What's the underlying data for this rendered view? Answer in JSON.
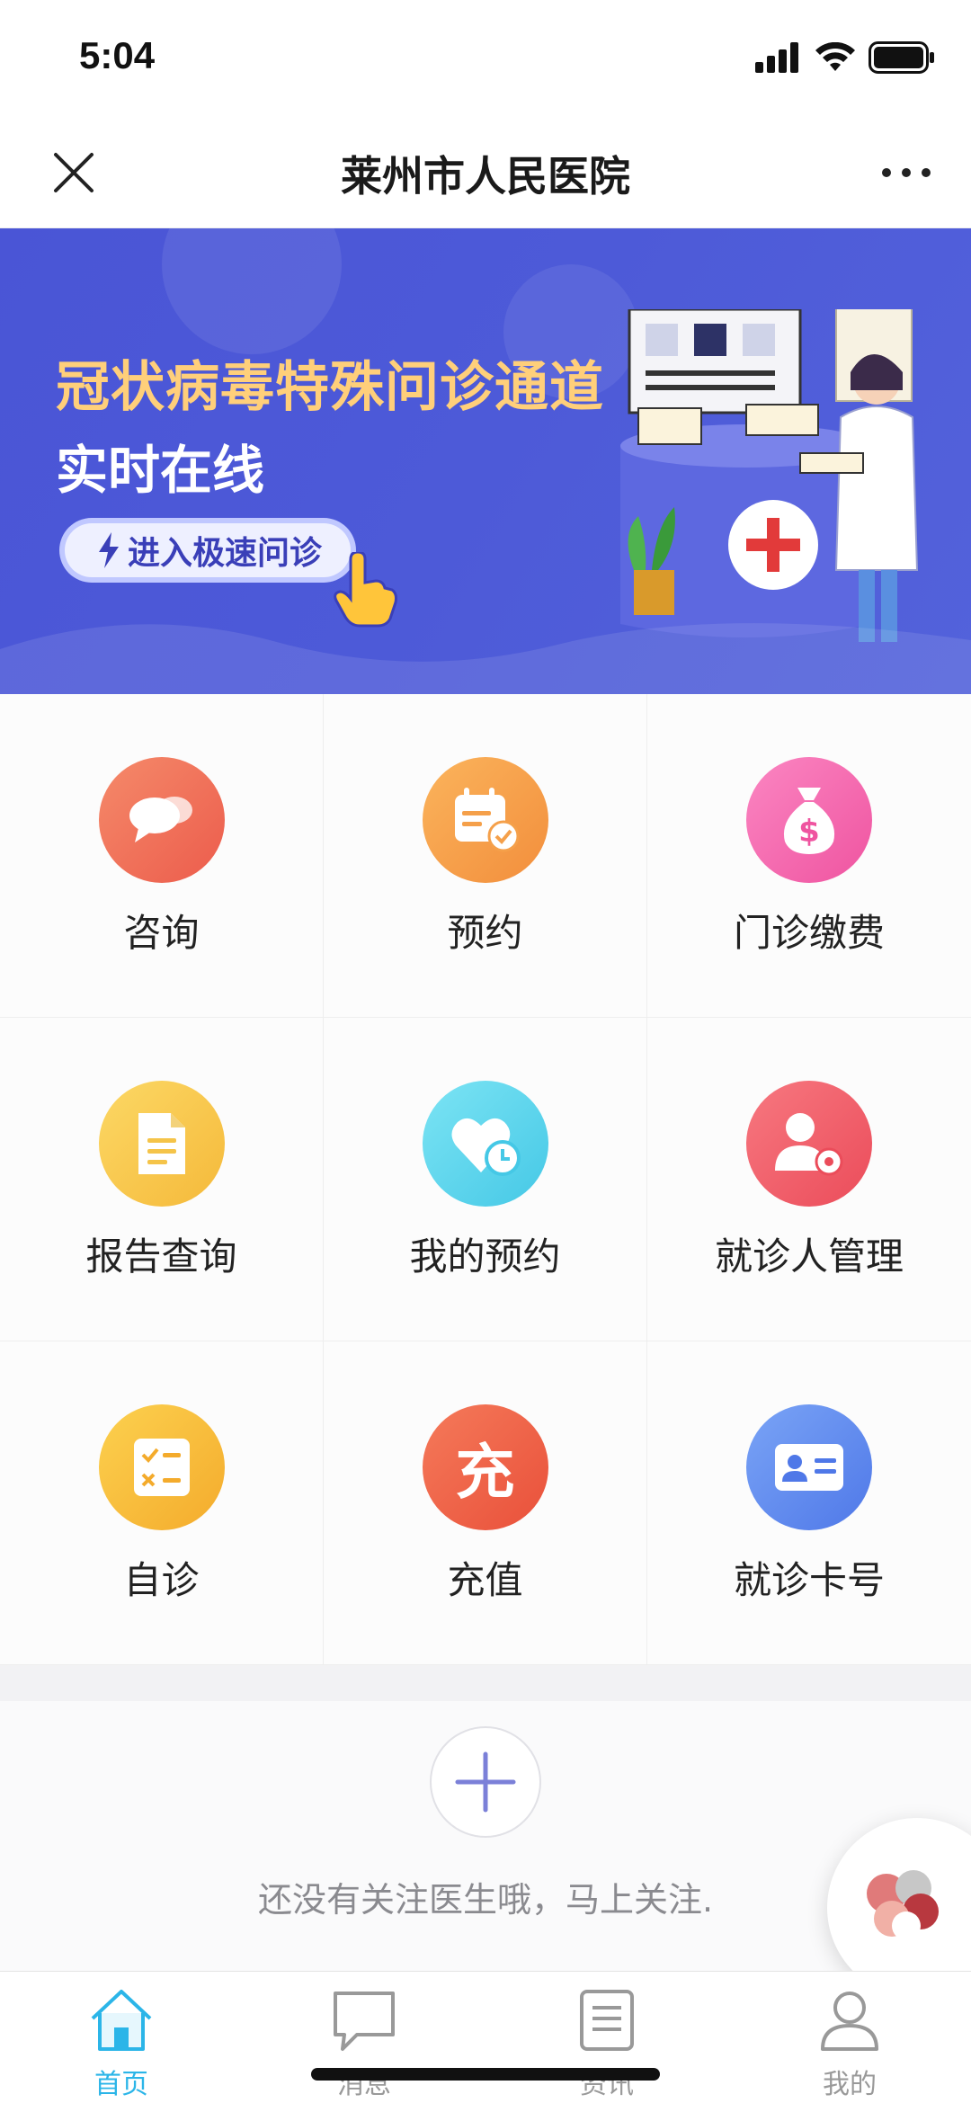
{
  "status_bar": {
    "time": "5:04"
  },
  "nav": {
    "title": "莱州市人民医院"
  },
  "banner": {
    "title": "冠状病毒特殊问诊通道",
    "subtitle": "实时在线",
    "button_label": "进入极速问诊"
  },
  "grid": {
    "items": [
      {
        "label": "咨询",
        "icon": "chat-bubbles-icon",
        "color": "#f0705a"
      },
      {
        "label": "预约",
        "icon": "calendar-check-icon",
        "color": "#f7a14a"
      },
      {
        "label": "门诊缴费",
        "icon": "money-bag-icon",
        "color": "#f56fb0"
      },
      {
        "label": "报告查询",
        "icon": "document-icon",
        "color": "#f7c94a"
      },
      {
        "label": "我的预约",
        "icon": "heart-clock-icon",
        "color": "#5fd5ec"
      },
      {
        "label": "就诊人管理",
        "icon": "person-gear-icon",
        "color": "#f2636e"
      },
      {
        "label": "自诊",
        "icon": "checklist-icon",
        "color": "#f8c33f"
      },
      {
        "label": "充值",
        "icon": "recharge-icon",
        "color": "#f0604a"
      },
      {
        "label": "就诊卡号",
        "icon": "id-card-icon",
        "color": "#5e8cf0"
      }
    ]
  },
  "follow": {
    "text": "还没有关注医生哦，马上关注."
  },
  "tabs": [
    {
      "label": "首页",
      "icon": "home-icon",
      "active": true
    },
    {
      "label": "消息",
      "icon": "message-icon",
      "active": false
    },
    {
      "label": "资讯",
      "icon": "news-icon",
      "active": false
    },
    {
      "label": "我的",
      "icon": "user-icon",
      "active": false
    }
  ],
  "colors": {
    "accent": "#2bb5e8",
    "banner_bg": "#4a55d6",
    "banner_title": "#ffcf7a"
  }
}
